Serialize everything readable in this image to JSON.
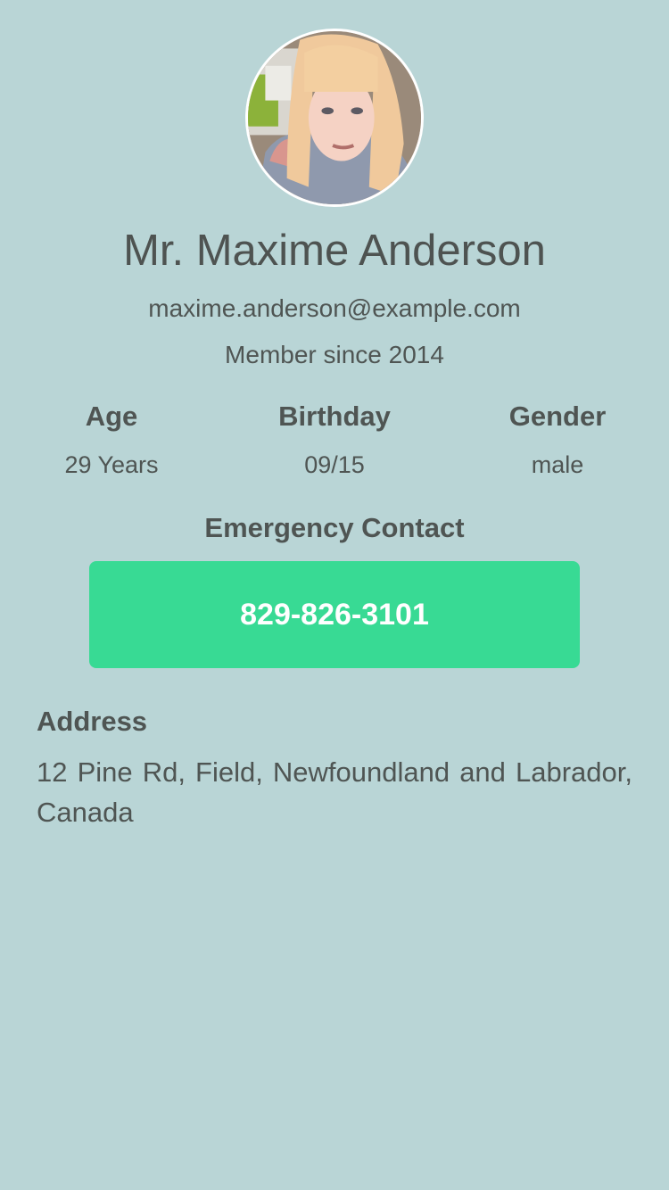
{
  "profile": {
    "avatar_icon": "profile-photo",
    "name": "Mr. Maxime Anderson",
    "email": "maxime.anderson@example.com",
    "member_since": "Member since 2014"
  },
  "stats": {
    "age_label": "Age",
    "age_value": "29 Years",
    "birthday_label": "Birthday",
    "birthday_value": "09/15",
    "gender_label": "Gender",
    "gender_value": "male"
  },
  "emergency": {
    "title": "Emergency Contact",
    "phone": "829-826-3101"
  },
  "address": {
    "title": "Address",
    "text": "12 Pine Rd, Field, Newfoundland and Labrador, Canada"
  },
  "colors": {
    "background": "#b9d5d6",
    "accent": "#38da94",
    "text": "#4f5553"
  }
}
